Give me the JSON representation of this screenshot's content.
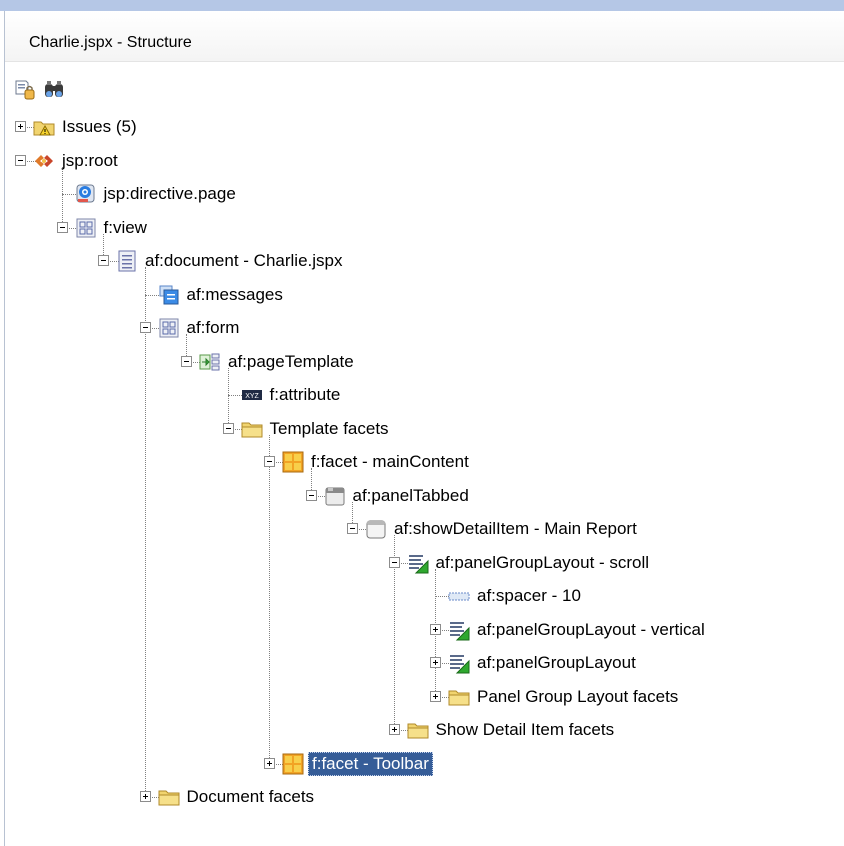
{
  "window": {
    "title": "Charlie.jspx - Structure"
  },
  "toolbar": [
    {
      "name": "freeze-view-icon"
    },
    {
      "name": "find-binoculars-icon"
    }
  ],
  "tree": [
    {
      "label": "Issues (5)",
      "icon": "warning-folder-icon",
      "level": 0,
      "expander": "plus"
    },
    {
      "label": "jsp:root",
      "icon": "jsp-root-icon",
      "level": 0,
      "expander": "minus"
    },
    {
      "label": "jsp:directive.page",
      "icon": "directive-icon",
      "level": 1,
      "expander": "none"
    },
    {
      "label": "f:view",
      "icon": "view-icon",
      "level": 1,
      "expander": "minus"
    },
    {
      "label": "af:document - Charlie.jspx",
      "icon": "document-icon",
      "level": 2,
      "expander": "minus"
    },
    {
      "label": "af:messages",
      "icon": "messages-icon",
      "level": 3,
      "expander": "none"
    },
    {
      "label": "af:form",
      "icon": "form-icon",
      "level": 3,
      "expander": "minus"
    },
    {
      "label": "af:pageTemplate",
      "icon": "page-template-icon",
      "level": 4,
      "expander": "minus"
    },
    {
      "label": "f:attribute",
      "icon": "attribute-icon",
      "level": 5,
      "expander": "none"
    },
    {
      "label": "Template facets",
      "icon": "folder-icon",
      "level": 5,
      "expander": "minus"
    },
    {
      "label": "f:facet - mainContent",
      "icon": "facet-icon",
      "level": 6,
      "expander": "minus"
    },
    {
      "label": "af:panelTabbed",
      "icon": "panel-tabbed-icon",
      "level": 7,
      "expander": "minus"
    },
    {
      "label": "af:showDetailItem - Main Report",
      "icon": "show-detail-item-icon",
      "level": 8,
      "expander": "minus"
    },
    {
      "label": "af:panelGroupLayout - scroll",
      "icon": "panel-group-layout-icon",
      "level": 9,
      "expander": "minus"
    },
    {
      "label": "af:spacer - 10",
      "icon": "spacer-icon",
      "level": 10,
      "expander": "none"
    },
    {
      "label": "af:panelGroupLayout - vertical",
      "icon": "panel-group-layout-icon",
      "level": 10,
      "expander": "plus"
    },
    {
      "label": "af:panelGroupLayout",
      "icon": "panel-group-layout-icon",
      "level": 10,
      "expander": "plus"
    },
    {
      "label": "Panel Group Layout facets",
      "icon": "folder-icon",
      "level": 10,
      "expander": "plus"
    },
    {
      "label": "Show Detail Item facets",
      "icon": "folder-icon",
      "level": 9,
      "expander": "plus"
    },
    {
      "label": "f:facet - Toolbar",
      "icon": "facet-icon",
      "level": 6,
      "expander": "plus",
      "selected": true
    },
    {
      "label": "Document facets",
      "icon": "folder-icon",
      "level": 3,
      "expander": "plus"
    }
  ],
  "colors": {
    "selection": "#365d98",
    "folder": "#f1d46f",
    "accent": "#1f6fd6"
  }
}
